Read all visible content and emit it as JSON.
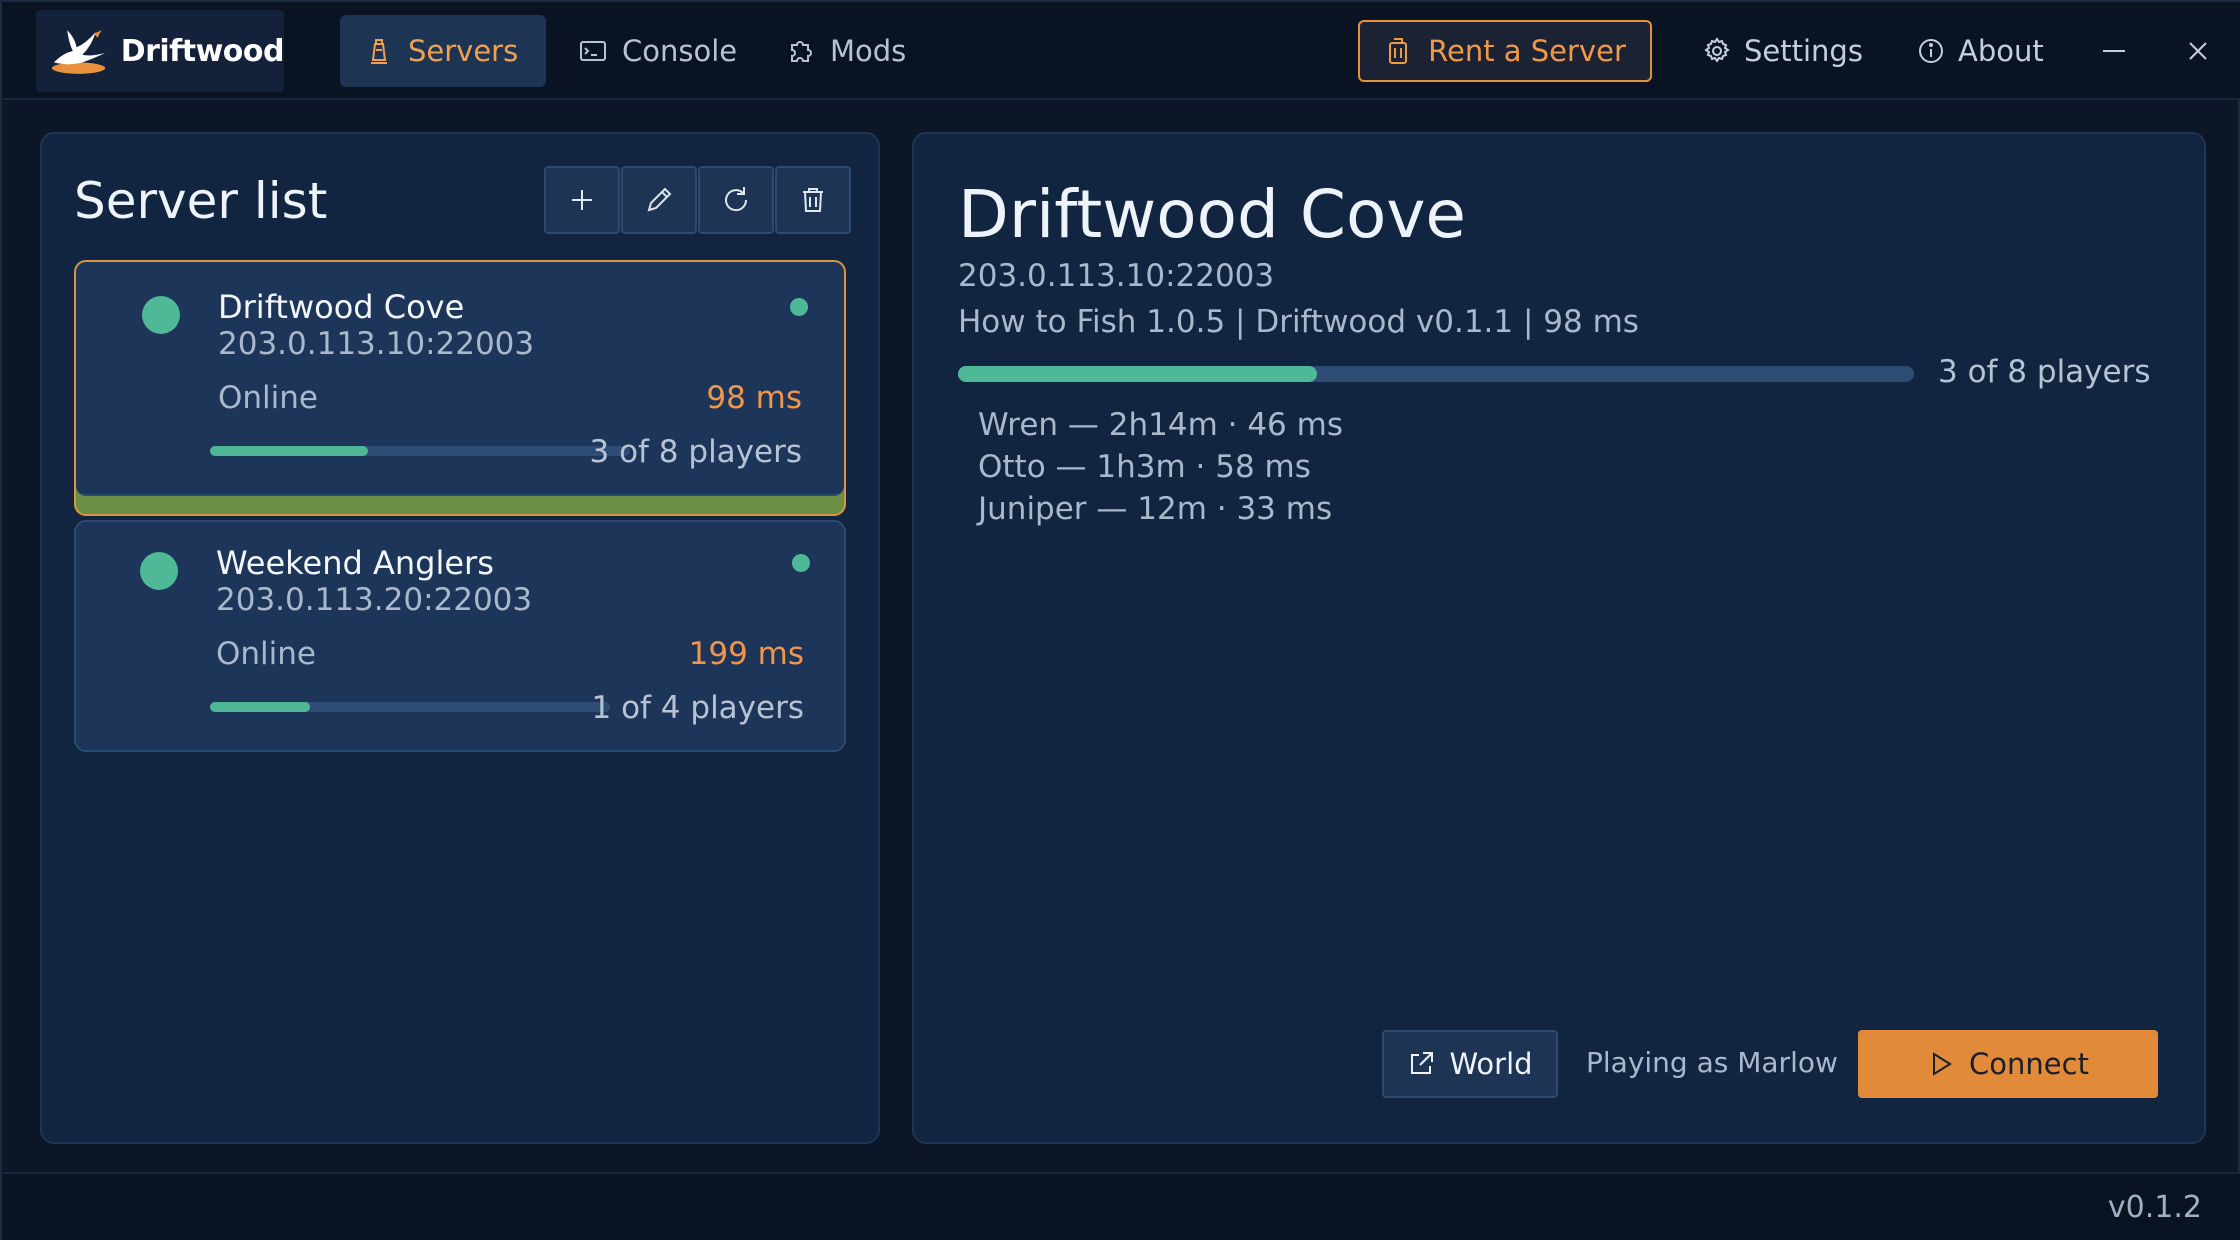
{
  "app": {
    "logo_text": "Driftwood",
    "version": "v0.1.2"
  },
  "nav": {
    "tabs": [
      {
        "label": "Servers",
        "icon": "lighthouse-icon",
        "active": true
      },
      {
        "label": "Console",
        "icon": "terminal-icon",
        "active": false
      },
      {
        "label": "Mods",
        "icon": "puzzle-icon",
        "active": false
      }
    ],
    "rent_label": "Rent a Server",
    "settings_label": "Settings",
    "about_label": "About"
  },
  "server_list": {
    "title": "Server list",
    "servers": [
      {
        "name": "Driftwood Cove",
        "address": "203.0.113.10:22003",
        "status": "Online",
        "ping": "98 ms",
        "players_label": "3 of 8 players",
        "players_fill": 0.375,
        "selected": true
      },
      {
        "name": "Weekend Anglers",
        "address": "203.0.113.20:22003",
        "status": "Online",
        "ping": "199 ms",
        "players_label": "1 of 4 players",
        "players_fill": 0.25,
        "selected": false
      }
    ]
  },
  "details": {
    "name": "Driftwood Cove",
    "address": "203.0.113.10:22003",
    "info": "How to Fish 1.0.5 | Driftwood v0.1.1 | 98 ms",
    "players_label": "3 of 8 players",
    "players_fill": 0.375,
    "players": [
      "Wren — 2h14m · 46 ms",
      "Otto — 1h3m · 58 ms",
      "Juniper — 12m · 33 ms"
    ],
    "world_label": "World",
    "playing_as": "Playing as Marlow",
    "connect_label": "Connect"
  },
  "colors": {
    "accent": "#e08a3a",
    "online": "#4fb896",
    "panel": "#112440",
    "background": "#0c1626"
  }
}
